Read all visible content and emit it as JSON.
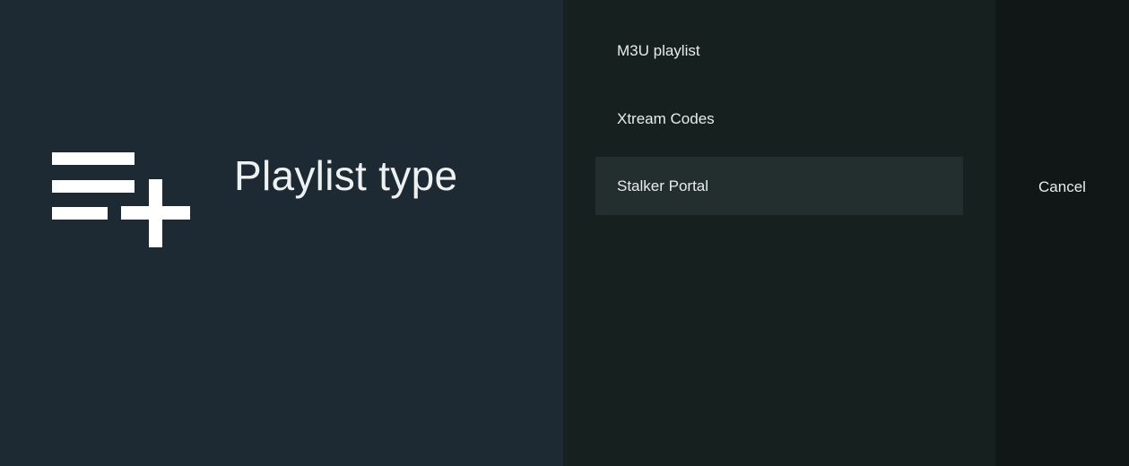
{
  "dialog": {
    "title": "Playlist type",
    "icon": "playlist-add-icon"
  },
  "options": [
    {
      "label": "M3U playlist",
      "selected": false
    },
    {
      "label": "Xtream Codes",
      "selected": false
    },
    {
      "label": "Stalker Portal",
      "selected": true
    }
  ],
  "actions": {
    "cancel_label": "Cancel"
  },
  "colors": {
    "left_panel": "#1e2a33",
    "options_panel": "#16201f",
    "selected_option": "#232e2e",
    "cancel_panel": "#101716",
    "text": "#e9ecec"
  }
}
